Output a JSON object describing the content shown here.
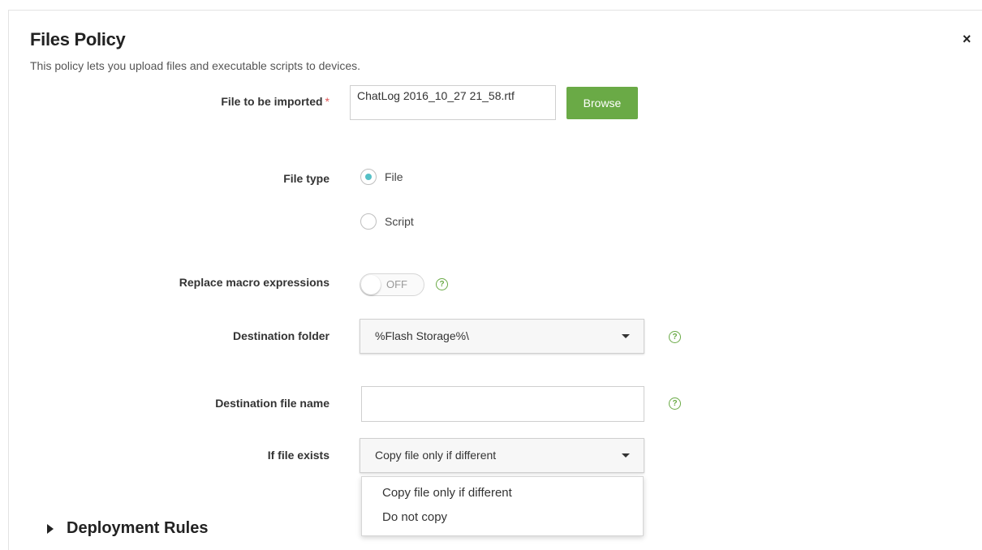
{
  "dialog": {
    "title": "Files Policy",
    "subtitle": "This policy lets you upload files and executable scripts to devices.",
    "close_icon": "×"
  },
  "file_import": {
    "label": "File to be imported",
    "required_mark": "*",
    "value": "ChatLog 2016_10_27 21_58.rtf",
    "browse_label": "Browse"
  },
  "file_type": {
    "label": "File type",
    "options": [
      "File",
      "Script"
    ],
    "selected": "File"
  },
  "replace_macro": {
    "label": "Replace macro expressions",
    "toggle_text": "OFF",
    "help_icon": "?"
  },
  "destination_folder": {
    "label": "Destination folder",
    "value": "%Flash Storage%\\",
    "help_icon": "?"
  },
  "destination_file_name": {
    "label": "Destination file name",
    "value": "",
    "help_icon": "?"
  },
  "if_file_exists": {
    "label": "If file exists",
    "value": "Copy file only if different",
    "options": [
      "Copy file only if different",
      "Do not copy"
    ]
  },
  "deployment_rules": {
    "label": "Deployment Rules"
  },
  "colors": {
    "accent_green": "#6aaa46",
    "radio_selected": "#55c0c6",
    "required_red": "#e05555"
  }
}
